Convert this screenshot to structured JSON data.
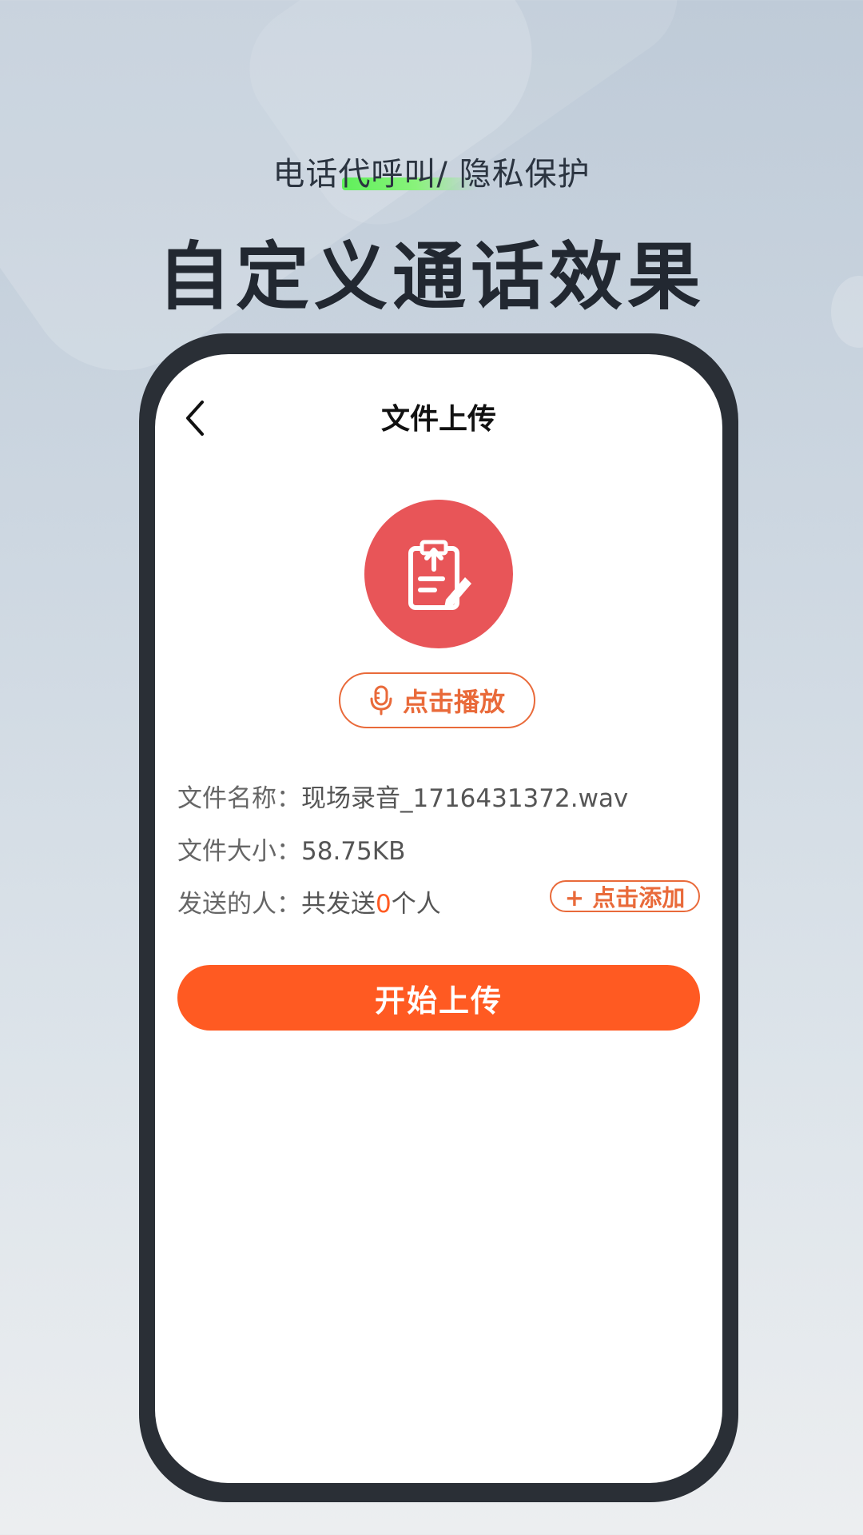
{
  "promo": {
    "subtitle": "电话代呼叫/ 隐私保护",
    "headline": "自定义通话效果"
  },
  "screen": {
    "nav_title": "文件上传",
    "play_button_label": "点击播放",
    "file_name_label": "文件名称：",
    "file_name_value": "现场录音_1716431372.wav",
    "file_size_label": "文件大小：",
    "file_size_value": "58.75KB",
    "recipients_label": "发送的人：",
    "recipients_prefix": "共发送",
    "recipients_count": "0",
    "recipients_suffix": "个人",
    "add_button_label": "+ 点击添加",
    "start_upload_label": "开始上传"
  },
  "icons": {
    "back": "chevron-left-icon",
    "upload_file": "clipboard-upload-icon",
    "microphone": "microphone-icon"
  },
  "colors": {
    "accent_orange": "#ff5a22",
    "icon_red": "#e85558",
    "outline_orange": "#e96a3a"
  }
}
